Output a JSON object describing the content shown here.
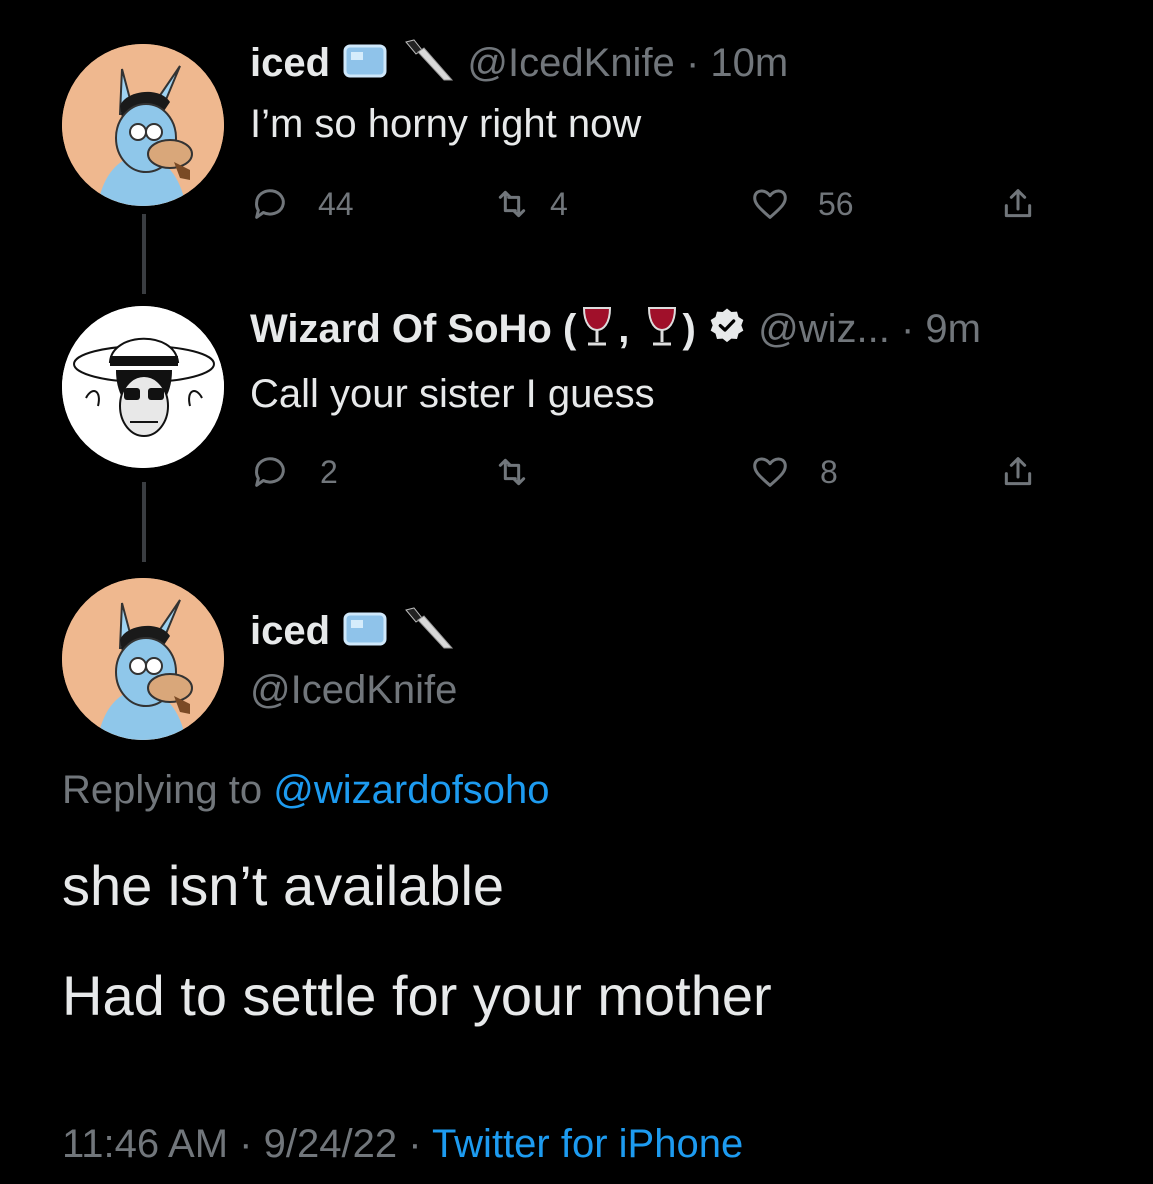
{
  "tweets": [
    {
      "name": "iced",
      "handle": "@IcedKnife",
      "separator": "·",
      "time": "10m",
      "text": "I’m so horny right now",
      "replies": "44",
      "retweets": "4",
      "likes": "56"
    },
    {
      "name": "Wizard Of SoHo (",
      "name_mid": ",",
      "name_end": ")",
      "handle": "@wiz...",
      "separator": "·",
      "time": "9m",
      "text": "Call your sister I guess",
      "replies": "2",
      "retweets": "",
      "likes": "8"
    }
  ],
  "main_tweet": {
    "name": "iced",
    "handle": "@IcedKnife",
    "replying_label": "Replying to",
    "replying_handle": "@wizardofsoho",
    "line1": "she isn’t available",
    "line2": "Had to settle for your mother",
    "timestamp": "11:46 AM",
    "sep1": "·",
    "date": "9/24/22",
    "sep2": "·",
    "source": "Twitter for iPhone"
  },
  "colors": {
    "background": "#000000",
    "text": "#e7e9ea",
    "muted": "#71767b",
    "link": "#1d9bf0",
    "avatar_iced_bg": "#efb88f",
    "avatar_wizard_bg": "#ffffff"
  },
  "icons": {
    "reply": "reply-icon",
    "retweet": "retweet-icon",
    "like": "heart-icon",
    "share": "share-icon",
    "verified": "verified-badge-icon",
    "ice": "ice-cube-emoji",
    "knife": "knife-emoji",
    "wine": "wine-glass-emoji"
  }
}
